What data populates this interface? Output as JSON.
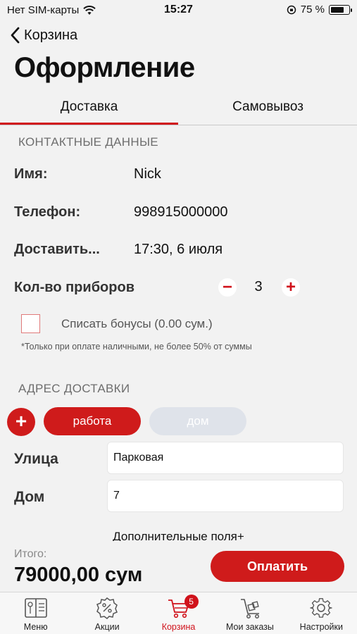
{
  "status_bar": {
    "carrier": "Нет SIM-карты",
    "time": "15:27",
    "battery": "75 %",
    "battery_level": 0.75
  },
  "nav": {
    "back_label": "Корзина"
  },
  "page_title": "Оформление",
  "tabs": [
    {
      "label": "Доставка",
      "active": true
    },
    {
      "label": "Самовывоз",
      "active": false
    }
  ],
  "contact": {
    "section_title": "КОНТАКТНЫЕ ДАННЫЕ",
    "name_label": "Имя:",
    "name_value": "Nick",
    "phone_label": "Телефон:",
    "phone_value": "998915000000",
    "delivery_label": "Доставить...",
    "delivery_value": "17:30, 6 июля",
    "cutlery_label": "Кол-во приборов",
    "cutlery_count": "3",
    "bonus_label": "Списать бонусы",
    "bonus_amount": "(0.00 сум.)",
    "bonus_note": "*Только при оплате наличными, не более 50% от суммы"
  },
  "address": {
    "section_title": "АДРЕС ДОСТАВКИ",
    "add_symbol": "+",
    "chips": [
      "работа",
      "дом"
    ],
    "street_label": "Улица",
    "street_value": "Парковая",
    "house_label": "Дом",
    "house_value": "7",
    "extra_fields": "Дополнительные поля+"
  },
  "footer": {
    "total_label": "Итого:",
    "total_value": "79000,00 сум",
    "pay_label": "Оплатить"
  },
  "tabbar": {
    "items": [
      {
        "label": "Меню",
        "icon": "menu-book-icon"
      },
      {
        "label": "Акции",
        "icon": "discount-icon"
      },
      {
        "label": "Корзина",
        "icon": "cart-icon",
        "badge": "5",
        "active": true
      },
      {
        "label": "Мои заказы",
        "icon": "orders-trolley-icon"
      },
      {
        "label": "Настройки",
        "icon": "settings-gear-icon"
      }
    ]
  },
  "colors": {
    "accent": "#cf1b1b",
    "inactive_chip": "#dfe3ea",
    "background": "#f2f2f2"
  }
}
